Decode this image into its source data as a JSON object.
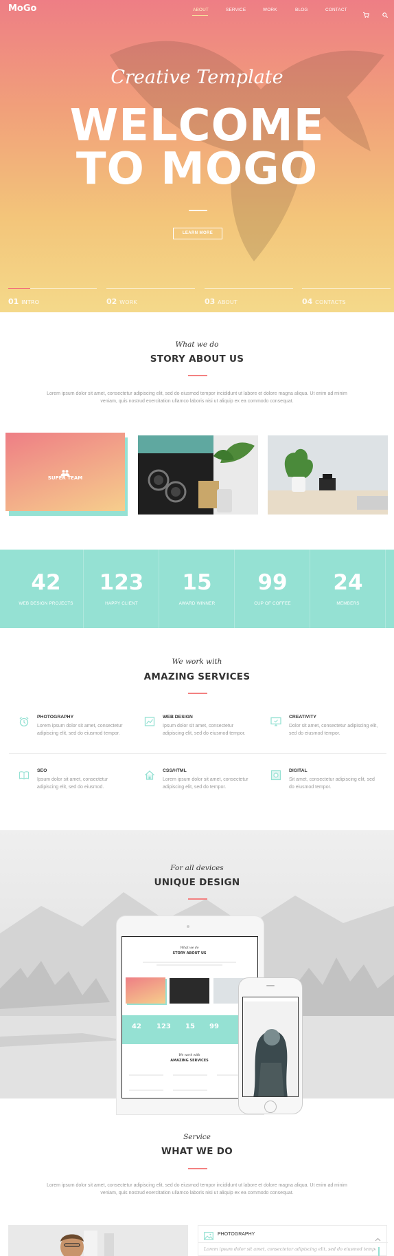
{
  "header": {
    "logo": "MoGo",
    "nav": [
      {
        "label": "ABOUT",
        "active": true
      },
      {
        "label": "SERVICE",
        "active": false
      },
      {
        "label": "WORK",
        "active": false
      },
      {
        "label": "BLOG",
        "active": false
      },
      {
        "label": "CONTACT",
        "active": false
      }
    ],
    "cart_icon": "cart-icon",
    "search_icon": "search-icon"
  },
  "hero": {
    "script": "Creative Template",
    "title_line1": "WELCOME",
    "title_line2": "TO MOGO",
    "button": "LEARN MORE",
    "slides": [
      {
        "num": "01",
        "label": "INTRO",
        "progress": 0.25
      },
      {
        "num": "02",
        "label": "WORK",
        "progress": 0
      },
      {
        "num": "03",
        "label": "ABOUT",
        "progress": 0
      },
      {
        "num": "04",
        "label": "CONTACTS",
        "progress": 0
      }
    ]
  },
  "about": {
    "script": "What we do",
    "title": "STORY ABOUT US",
    "text_line1": "Lorem ipsum dolor sit amet, consectetur adipiscing elit, sed do eiusmod tempor incididunt ut labore et dolore magna aliqua. Ut enim ad minim",
    "text_line2": "veniam, quis nostrud exercitation ullamco laboris nisi ut aliquip ex ea commodo consequat.",
    "team_label": "SUPER TEAM"
  },
  "stats": [
    {
      "value": "42",
      "label": "WEB DESIGN PROJECTS"
    },
    {
      "value": "123",
      "label": "HAPPY CLIENT"
    },
    {
      "value": "15",
      "label": "AWARD WINNER"
    },
    {
      "value": "99",
      "label": "CUP OF COFFEE"
    },
    {
      "value": "24",
      "label": "MEMBERS"
    }
  ],
  "services": {
    "script": "We work with",
    "title": "AMAZING SERVICES",
    "items": [
      {
        "icon": "alarm-clock-icon",
        "title": "PHOTOGRAPHY",
        "line1": "Lorem ipsum dolor sit amet, consectetur",
        "line2": "adipiscing elit, sed do eiusmod tempor."
      },
      {
        "icon": "chart-icon",
        "title": "WEB DESIGN",
        "line1": "Ipsum dolor sit amet, consectetur",
        "line2": "adipiscing elit, sed do eiusmod tempor."
      },
      {
        "icon": "monitor-icon",
        "title": "CREATIVITY",
        "line1": "Dolor sit amet, consectetur adipiscing elit,",
        "line2": "sed do eiusmod tempor."
      },
      {
        "icon": "book-icon",
        "title": "SEO",
        "line1": "Ipsum dolor sit amet, consectetur",
        "line2": "adipiscing elit, sed do eiusmod."
      },
      {
        "icon": "house-icon",
        "title": "CSS/HTML",
        "line1": "Lorem ipsum dolor sit amet, consectetur",
        "line2": "adipiscing elit, sed do tempor."
      },
      {
        "icon": "lifebuoy-icon",
        "title": "DIGITAL",
        "line1": "Sit amet, consectetur adipiscing elit, sed",
        "line2": "do eiusmod tempor."
      }
    ]
  },
  "devices": {
    "script": "For all devices",
    "title": "UNIQUE DESIGN",
    "mock_script": "What we do",
    "mock_title": "STORY ABOUT US",
    "mock_stats": [
      "42",
      "123",
      "15",
      "99"
    ],
    "mock_script2": "We work with",
    "mock_title2": "AMAZING SERVICES"
  },
  "what_we_do": {
    "script": "Service",
    "title": "WHAT WE DO",
    "text_line1": "Lorem ipsum dolor sit amet, consectetur adipiscing elit, sed do eiusmod tempor incididunt ut labore et dolore magna aliqua. Ut enim ad minim",
    "text_line2": "veniam, quis nostrud exercitation ullamco laboris nisi ut aliquip ex ea commodo consequat.",
    "accordion_title": "PHOTOGRAPHY",
    "accordion_text": "Lorem ipsum dolor sit amet, consectetur adipiscing elit, sed do eiusmod tempor"
  },
  "colors": {
    "accent_pink": "#f38181",
    "accent_mint": "#95e1d3",
    "hero_top": "#ee7e85",
    "hero_bottom": "#f4d98a"
  }
}
